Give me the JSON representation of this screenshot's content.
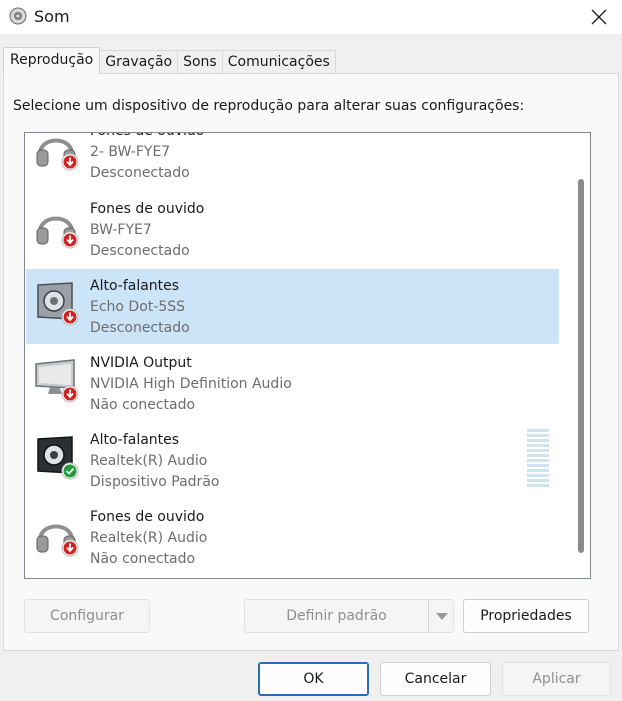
{
  "window": {
    "title": "Som",
    "icon": "speaker-icon",
    "close_icon": "close-icon"
  },
  "tabs": [
    {
      "label": "Reprodução",
      "active": true
    },
    {
      "label": "Gravação",
      "active": false
    },
    {
      "label": "Sons",
      "active": false
    },
    {
      "label": "Comunicações",
      "active": false
    }
  ],
  "instruction": "Selecione um dispositivo de reprodução para alterar suas configurações:",
  "devices": [
    {
      "name": "Fones de ouvido",
      "description": "2- BW-FYE7",
      "status": "Desconectado",
      "icon": "headphones-icon",
      "badge": "disconnected-arrow-icon",
      "selected": false
    },
    {
      "name": "Fones de ouvido",
      "description": "BW-FYE7",
      "status": "Desconectado",
      "icon": "headphones-icon",
      "badge": "disconnected-arrow-icon",
      "selected": false
    },
    {
      "name": "Alto-falantes",
      "description": "Echo Dot-5SS",
      "status": "Desconectado",
      "icon": "speaker-icon",
      "badge": "disconnected-arrow-icon",
      "selected": true
    },
    {
      "name": "NVIDIA Output",
      "description": "NVIDIA High Definition Audio",
      "status": "Não conectado",
      "icon": "monitor-icon",
      "badge": "disconnected-arrow-icon",
      "selected": false
    },
    {
      "name": "Alto-falantes",
      "description": "Realtek(R) Audio",
      "status": "Dispositivo Padrão",
      "icon": "speaker-icon",
      "badge": "default-check-icon",
      "selected": false
    },
    {
      "name": "Fones de ouvido",
      "description": "Realtek(R) Audio",
      "status": "Não conectado",
      "icon": "headphones-icon",
      "badge": "disconnected-arrow-icon",
      "selected": false
    }
  ],
  "buttons": {
    "configure": "Configurar",
    "set_default": "Definir padrão",
    "properties": "Propriedades",
    "ok": "OK",
    "cancel": "Cancelar",
    "apply": "Aplicar"
  },
  "colors": {
    "selection": "#cce4f7",
    "default_check": "#1f9d3a",
    "disconnected_badge": "#d32020",
    "default_button_border": "#2a6db5"
  }
}
